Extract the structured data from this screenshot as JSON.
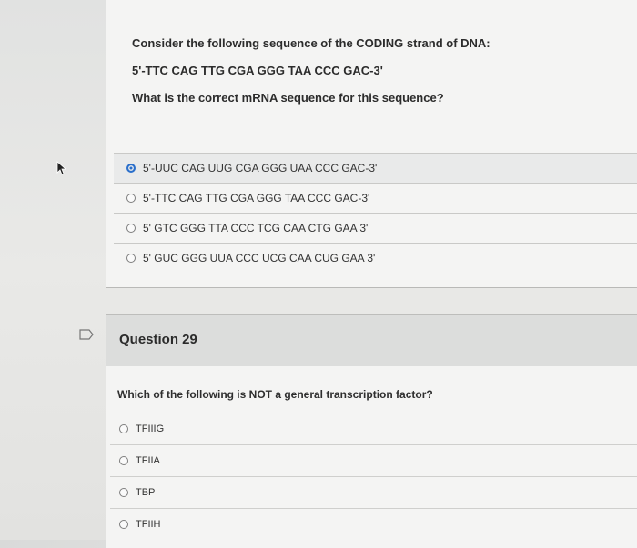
{
  "prev_question": {
    "prompt_line1": "Consider the following sequence of the CODING strand of DNA:",
    "prompt_line2": "5'-TTC CAG TTG CGA GGG TAA CCC GAC-3'",
    "prompt_line3": "What is the correct mRNA sequence for this sequence?",
    "answers": [
      {
        "label": "5'-UUC CAG UUG CGA GGG UAA CCC GAC-3'",
        "selected": true
      },
      {
        "label": "5'-TTC CAG TTG CGA GGG TAA CCC GAC-3'",
        "selected": false
      },
      {
        "label": "5' GTC GGG TTA CCC TCG CAA CTG GAA 3'",
        "selected": false
      },
      {
        "label": "5' GUC GGG UUA CCC UCG CAA CUG GAA 3'",
        "selected": false
      }
    ]
  },
  "question": {
    "title": "Question 29",
    "text": "Which of the following is NOT a general transcription factor?",
    "options": [
      "TFIIIG",
      "TFIIA",
      "TBP",
      "TFIIH"
    ]
  },
  "colors": {
    "selected_radio": "#2a6fcb"
  },
  "icons": {
    "flag": "flag-icon",
    "cursor": "mouse-pointer-icon"
  }
}
